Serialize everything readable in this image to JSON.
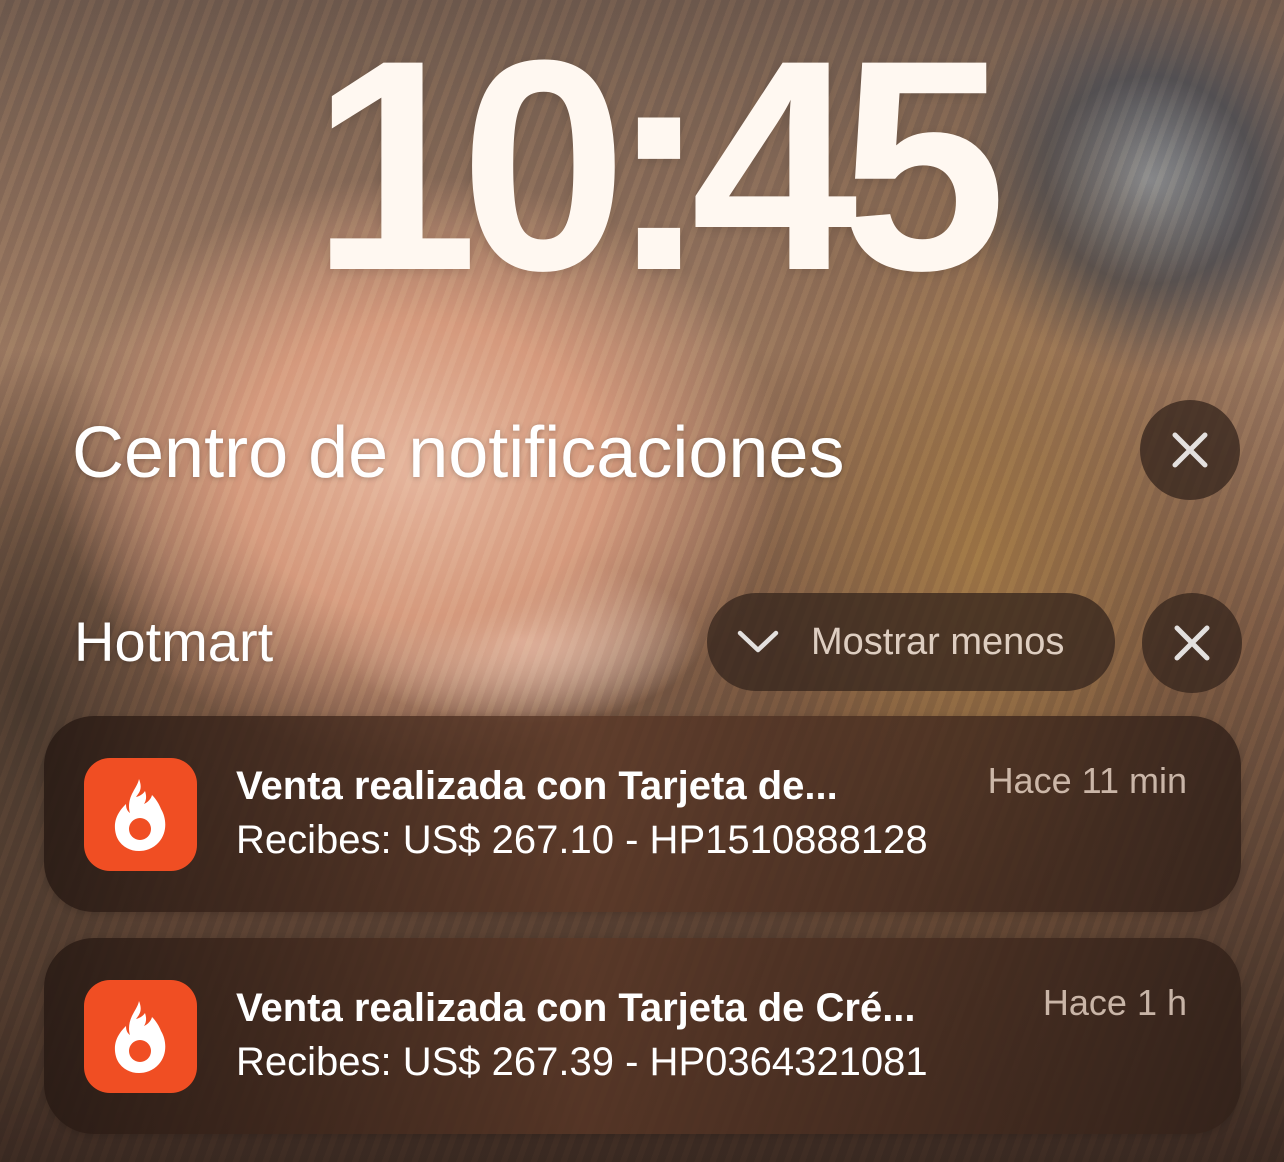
{
  "lock_screen": {
    "time": "10:45"
  },
  "notification_center": {
    "title": "Centro de notificaciones",
    "clear_icon": "close-icon"
  },
  "group": {
    "app_name": "Hotmart",
    "show_less_label": "Mostrar menos",
    "show_less_icon": "chevron-down-icon",
    "close_icon": "close-icon"
  },
  "notifications": [
    {
      "app_icon": "hotmart-flame-icon",
      "title": "Venta realizada con Tarjeta de...",
      "body": "Recibes: US$ 267.10 - HP1510888128",
      "time": "Hace 11 min"
    },
    {
      "app_icon": "hotmart-flame-icon",
      "title": "Venta realizada con Tarjeta de Cré...",
      "body": "Recibes: US$ 267.39 - HP0364321081",
      "time": "Hace 1 h"
    }
  ],
  "colors": {
    "hotmart_brand": "#f04e23",
    "text_primary": "#ffffff"
  }
}
